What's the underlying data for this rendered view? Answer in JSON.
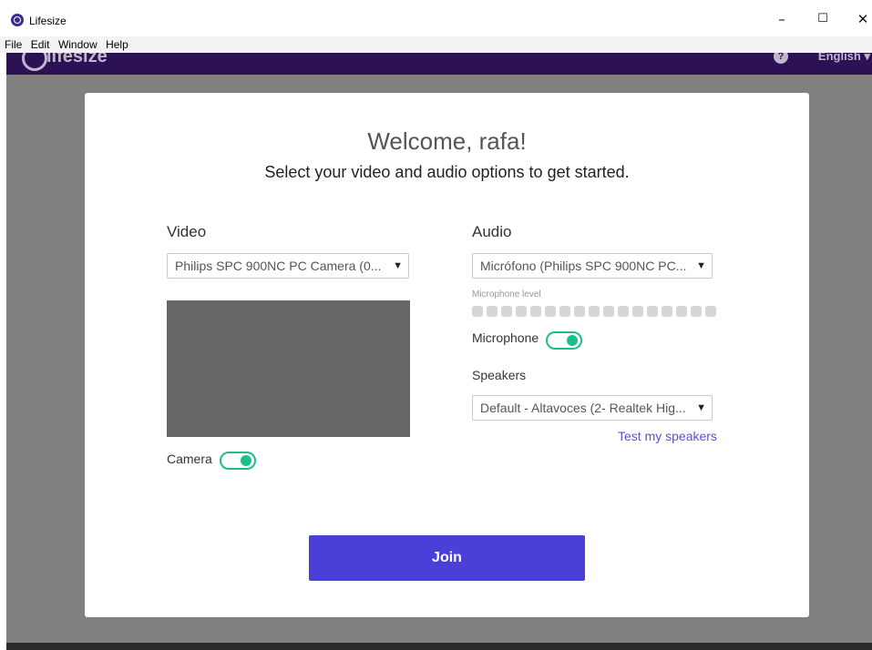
{
  "window": {
    "title": "Lifesize",
    "minimize": "–",
    "maximize": "☐",
    "close": "✕"
  },
  "menu": [
    "File",
    "Edit",
    "Window",
    "Help"
  ],
  "header": {
    "logo_text": "lifesize",
    "help": "?",
    "language": "English ▾",
    "bg_color": "#2c1155"
  },
  "card": {
    "welcome": "Welcome, rafa!",
    "subtitle": "Select your video and audio options to get started."
  },
  "video": {
    "label": "Video",
    "camera_select": "Philips SPC 900NC PC Camera (0...",
    "camera_toggle_label": "Camera",
    "camera_on": true
  },
  "audio": {
    "label": "Audio",
    "mic_select": "Micrófono (Philips SPC 900NC PC...",
    "mic_level_label": "Microphone level",
    "mic_level_dots": 17,
    "mic_toggle_label": "Microphone",
    "mic_on": true,
    "speakers_label": "Speakers",
    "speaker_select": "Default - Altavoces (2- Realtek Hig...",
    "test_speakers": "Test my speakers"
  },
  "join_label": "Join",
  "colors": {
    "accent": "#4a40d8",
    "toggle_on": "#1cbf8a",
    "backdrop": "#808080"
  }
}
